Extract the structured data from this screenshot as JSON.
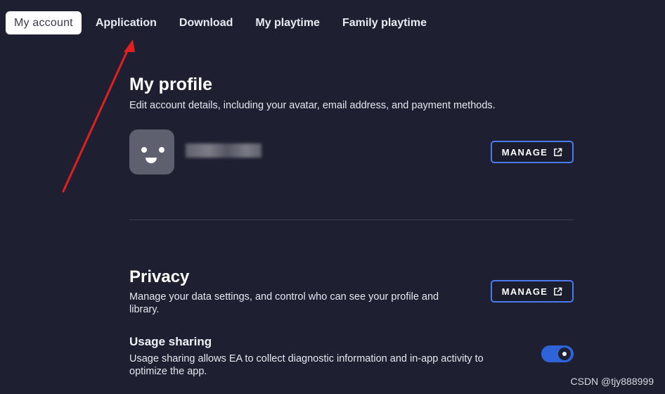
{
  "tabs": [
    {
      "label": "My account",
      "active": true
    },
    {
      "label": "Application"
    },
    {
      "label": "Download"
    },
    {
      "label": "My playtime"
    },
    {
      "label": "Family playtime"
    }
  ],
  "profile": {
    "title": "My profile",
    "description": "Edit account details, including your avatar, email address, and payment methods.",
    "manage_label": "MANAGE"
  },
  "privacy": {
    "title": "Privacy",
    "description": "Manage your data settings, and control who can see your profile and library.",
    "manage_label": "MANAGE",
    "usage_sharing": {
      "title": "Usage sharing",
      "description": "Usage sharing allows EA to collect diagnostic information and in-app activity to optimize the app.",
      "enabled": true
    }
  },
  "icons": {
    "external_link": "external-link-icon",
    "avatar": "smiley-face-icon",
    "annotation_arrow": "red-arrow-icon"
  },
  "colors": {
    "background": "#1e1f31",
    "accent": "#4c7bf0",
    "toggle_on": "#2f63d8",
    "annotation": "#e02020"
  },
  "watermark": "CSDN @tjy888999"
}
